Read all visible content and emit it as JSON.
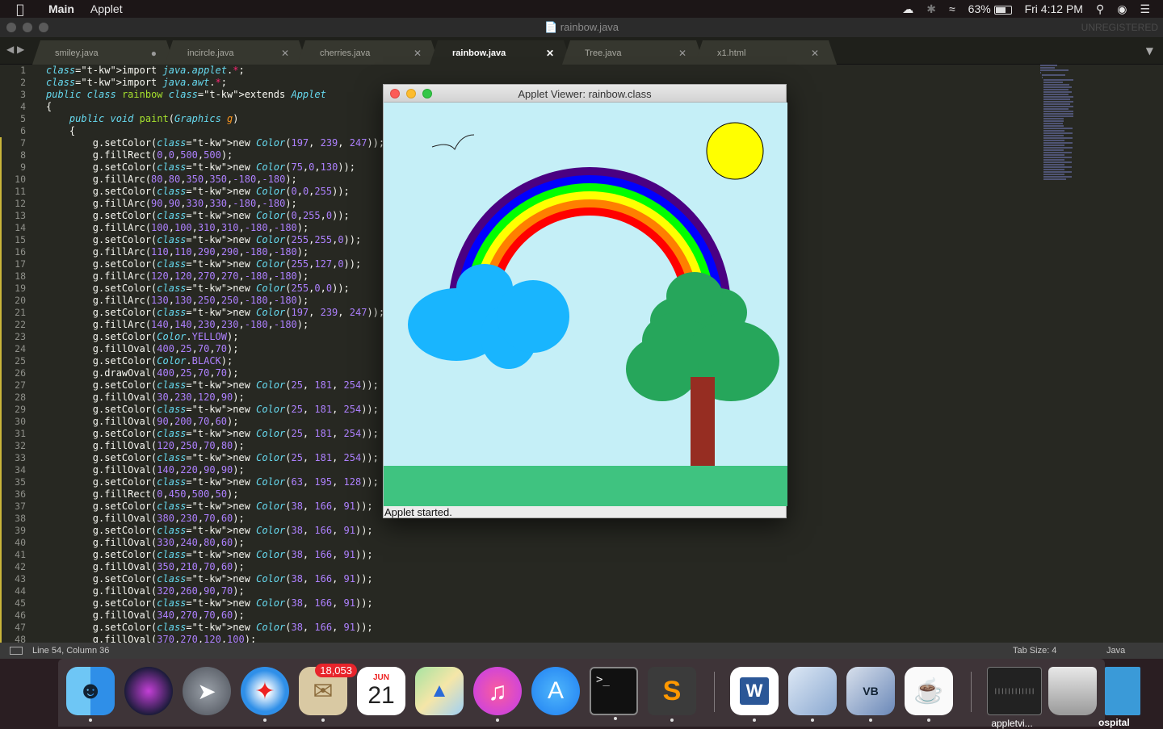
{
  "menubar": {
    "app_name": "Main",
    "menu": "Applet",
    "battery": "63%",
    "clock": "Fri 4:12 PM"
  },
  "editor": {
    "window_title": "rainbow.java",
    "unregistered": "UNREGISTERED",
    "tabs": [
      {
        "label": "smiley.java",
        "modified": true
      },
      {
        "label": "incircle.java",
        "modified": false
      },
      {
        "label": "cherries.java",
        "modified": false
      },
      {
        "label": "rainbow.java",
        "modified": false,
        "active": true
      },
      {
        "label": "Tree.java",
        "modified": false
      },
      {
        "label": "x1.html",
        "modified": false
      }
    ],
    "line_numbers": [
      "1",
      "2",
      "3",
      "4",
      "5",
      "6",
      "7",
      "8",
      "9",
      "10",
      "11",
      "12",
      "13",
      "14",
      "15",
      "16",
      "17",
      "18",
      "19",
      "20",
      "21",
      "22",
      "23",
      "24",
      "25",
      "26",
      "27",
      "28",
      "29",
      "30",
      "31",
      "32",
      "33",
      "34",
      "35",
      "36",
      "37",
      "38",
      "39",
      "40",
      "41",
      "42",
      "43",
      "44",
      "45",
      "46",
      "47",
      "48"
    ],
    "modified_lines": [
      7,
      8,
      9,
      10,
      11,
      12,
      13,
      14,
      15,
      16,
      17,
      18,
      19,
      20,
      21,
      22,
      23,
      24,
      25,
      26,
      27,
      28,
      29,
      30,
      31,
      32,
      33,
      34,
      35,
      36,
      37,
      38,
      39,
      40,
      41,
      42,
      43,
      44,
      45,
      46,
      47,
      48
    ],
    "code_lines": [
      "import java.applet.*;",
      "import java.awt.*;",
      "public class rainbow extends Applet",
      "{",
      "    public void paint(Graphics g)",
      "    {",
      "        g.setColor(new Color(197, 239, 247));",
      "        g.fillRect(0,0,500,500);",
      "        g.setColor(new Color(75,0,130));",
      "        g.fillArc(80,80,350,350,-180,-180);",
      "        g.setColor(new Color(0,0,255));",
      "        g.fillArc(90,90,330,330,-180,-180);",
      "        g.setColor(new Color(0,255,0));",
      "        g.fillArc(100,100,310,310,-180,-180);",
      "        g.setColor(new Color(255,255,0));",
      "        g.fillArc(110,110,290,290,-180,-180);",
      "        g.setColor(new Color(255,127,0));",
      "        g.fillArc(120,120,270,270,-180,-180);",
      "        g.setColor(new Color(255,0,0));",
      "        g.fillArc(130,130,250,250,-180,-180);",
      "        g.setColor(new Color(197, 239, 247));",
      "        g.fillArc(140,140,230,230,-180,-180);",
      "        g.setColor(Color.YELLOW);",
      "        g.fillOval(400,25,70,70);",
      "        g.setColor(Color.BLACK);",
      "        g.drawOval(400,25,70,70);",
      "        g.setColor(new Color(25, 181, 254));",
      "        g.fillOval(30,230,120,90);",
      "        g.setColor(new Color(25, 181, 254));",
      "        g.fillOval(90,200,70,60);",
      "        g.setColor(new Color(25, 181, 254));",
      "        g.fillOval(120,250,70,80);",
      "        g.setColor(new Color(25, 181, 254));",
      "        g.fillOval(140,220,90,90);",
      "        g.setColor(new Color(63, 195, 128));",
      "        g.fillRect(0,450,500,50);",
      "        g.setColor(new Color(38, 166, 91));",
      "        g.fillOval(380,230,70,60);",
      "        g.setColor(new Color(38, 166, 91));",
      "        g.fillOval(330,240,80,60);",
      "        g.setColor(new Color(38, 166, 91));",
      "        g.fillOval(350,210,70,60);",
      "        g.setColor(new Color(38, 166, 91));",
      "        g.fillOval(320,260,90,70);",
      "        g.setColor(new Color(38, 166, 91));",
      "        g.fillOval(340,270,70,60);",
      "        g.setColor(new Color(38, 166, 91));",
      "        g.fillOval(370,270,120,100);"
    ],
    "status": {
      "position": "Line 54, Column 36",
      "tab_size": "Tab Size: 4",
      "syntax": "Java"
    }
  },
  "applet": {
    "window_title": "Applet Viewer: rainbow.class",
    "status": "Applet started.",
    "colors": {
      "sky": "#c5eff7",
      "ground": "#3fc380",
      "cloud": "#19b5fe",
      "foliage": "#26a65b",
      "trunk": "#962d22",
      "sun": "#ffff00",
      "rainbow": [
        "#4b0082",
        "#0000ff",
        "#00ff00",
        "#ffff00",
        "#ff7f00",
        "#ff0000"
      ]
    }
  },
  "dock": {
    "items": [
      {
        "name": "finder",
        "icon": "finder-icon"
      },
      {
        "name": "siri",
        "icon": "siri-icon"
      },
      {
        "name": "launchpad",
        "icon": "rocket-icon"
      },
      {
        "name": "safari",
        "icon": "compass-icon"
      },
      {
        "name": "mail",
        "icon": "mail-icon",
        "badge": "18,053"
      },
      {
        "name": "calendar",
        "icon": "calendar-icon",
        "month": "JUN",
        "day": "21"
      },
      {
        "name": "maps",
        "icon": "maps-icon"
      },
      {
        "name": "itunes",
        "icon": "music-note-icon"
      },
      {
        "name": "app-store",
        "icon": "app-store-icon"
      },
      {
        "name": "terminal",
        "icon": "terminal-icon"
      },
      {
        "name": "sublime-text",
        "icon": "sublime-icon"
      },
      {
        "name": "word",
        "icon": "word-icon"
      },
      {
        "name": "blank-app",
        "icon": "cube-icon"
      },
      {
        "name": "virtualbox",
        "icon": "virtualbox-icon"
      },
      {
        "name": "java",
        "icon": "java-icon"
      },
      {
        "name": "appletviewer",
        "icon": "appletviewer-icon",
        "label": "appletvi..."
      },
      {
        "name": "trash",
        "icon": "trash-icon"
      }
    ],
    "partial_label": "ospital"
  }
}
